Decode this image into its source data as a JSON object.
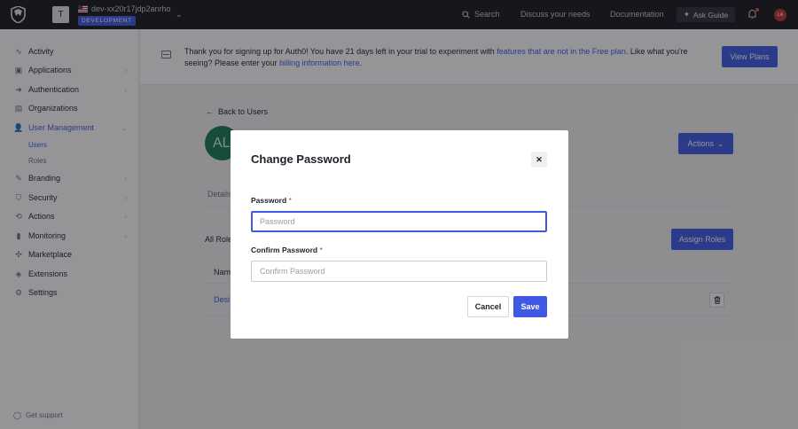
{
  "topbar": {
    "tenant_initial": "T",
    "tenant_name": "dev-xx20r17jdp2anrho",
    "environment": "DEVELOPMENT",
    "search_label": "Search",
    "discuss_label": "Discuss your needs",
    "documentation_label": "Documentation",
    "ask_guide_label": "Ask Guide",
    "user_initials": "LA"
  },
  "sidebar": {
    "items": [
      {
        "label": "Activity",
        "icon": "activity-icon"
      },
      {
        "label": "Applications",
        "icon": "applications-icon"
      },
      {
        "label": "Authentication",
        "icon": "authentication-icon"
      },
      {
        "label": "Organizations",
        "icon": "organizations-icon"
      },
      {
        "label": "User Management",
        "icon": "user-management-icon"
      },
      {
        "label": "Branding",
        "icon": "branding-icon"
      },
      {
        "label": "Security",
        "icon": "security-icon"
      },
      {
        "label": "Actions",
        "icon": "actions-icon"
      },
      {
        "label": "Monitoring",
        "icon": "monitoring-icon"
      },
      {
        "label": "Marketplace",
        "icon": "marketplace-icon"
      },
      {
        "label": "Extensions",
        "icon": "extensions-icon"
      },
      {
        "label": "Settings",
        "icon": "settings-icon"
      }
    ],
    "sub_items": [
      {
        "label": "Users"
      },
      {
        "label": "Roles"
      }
    ],
    "support_label": "Get support"
  },
  "banner": {
    "text_part1": "Thank you for signing up for Auth0! You have 21 days left in your trial to experiment with ",
    "link1": "features that are not in the Free plan",
    "text_part2": ". Like what you're seeing? Please enter your ",
    "link2": "billing information here",
    "text_part3": ".",
    "view_plans_label": "View Plans"
  },
  "main": {
    "back_label": "Back to Users",
    "user_avatar_initials": "AL",
    "actions_label": "Actions",
    "tab_details": "Details",
    "all_roles_label": "All Roles",
    "assign_roles_label": "Assign Roles",
    "table_header_name": "Name",
    "row_name": "Desi"
  },
  "modal": {
    "title": "Change Password",
    "password_label": "Password",
    "password_placeholder": "Password",
    "confirm_label": "Confirm Password",
    "confirm_placeholder": "Confirm Password",
    "required_mark": "*",
    "cancel_label": "Cancel",
    "save_label": "Save"
  },
  "colors": {
    "accent": "#3f59e4",
    "topbar": "#191a1e",
    "avatar": "#1a7a5a",
    "required": "#c2372d"
  }
}
